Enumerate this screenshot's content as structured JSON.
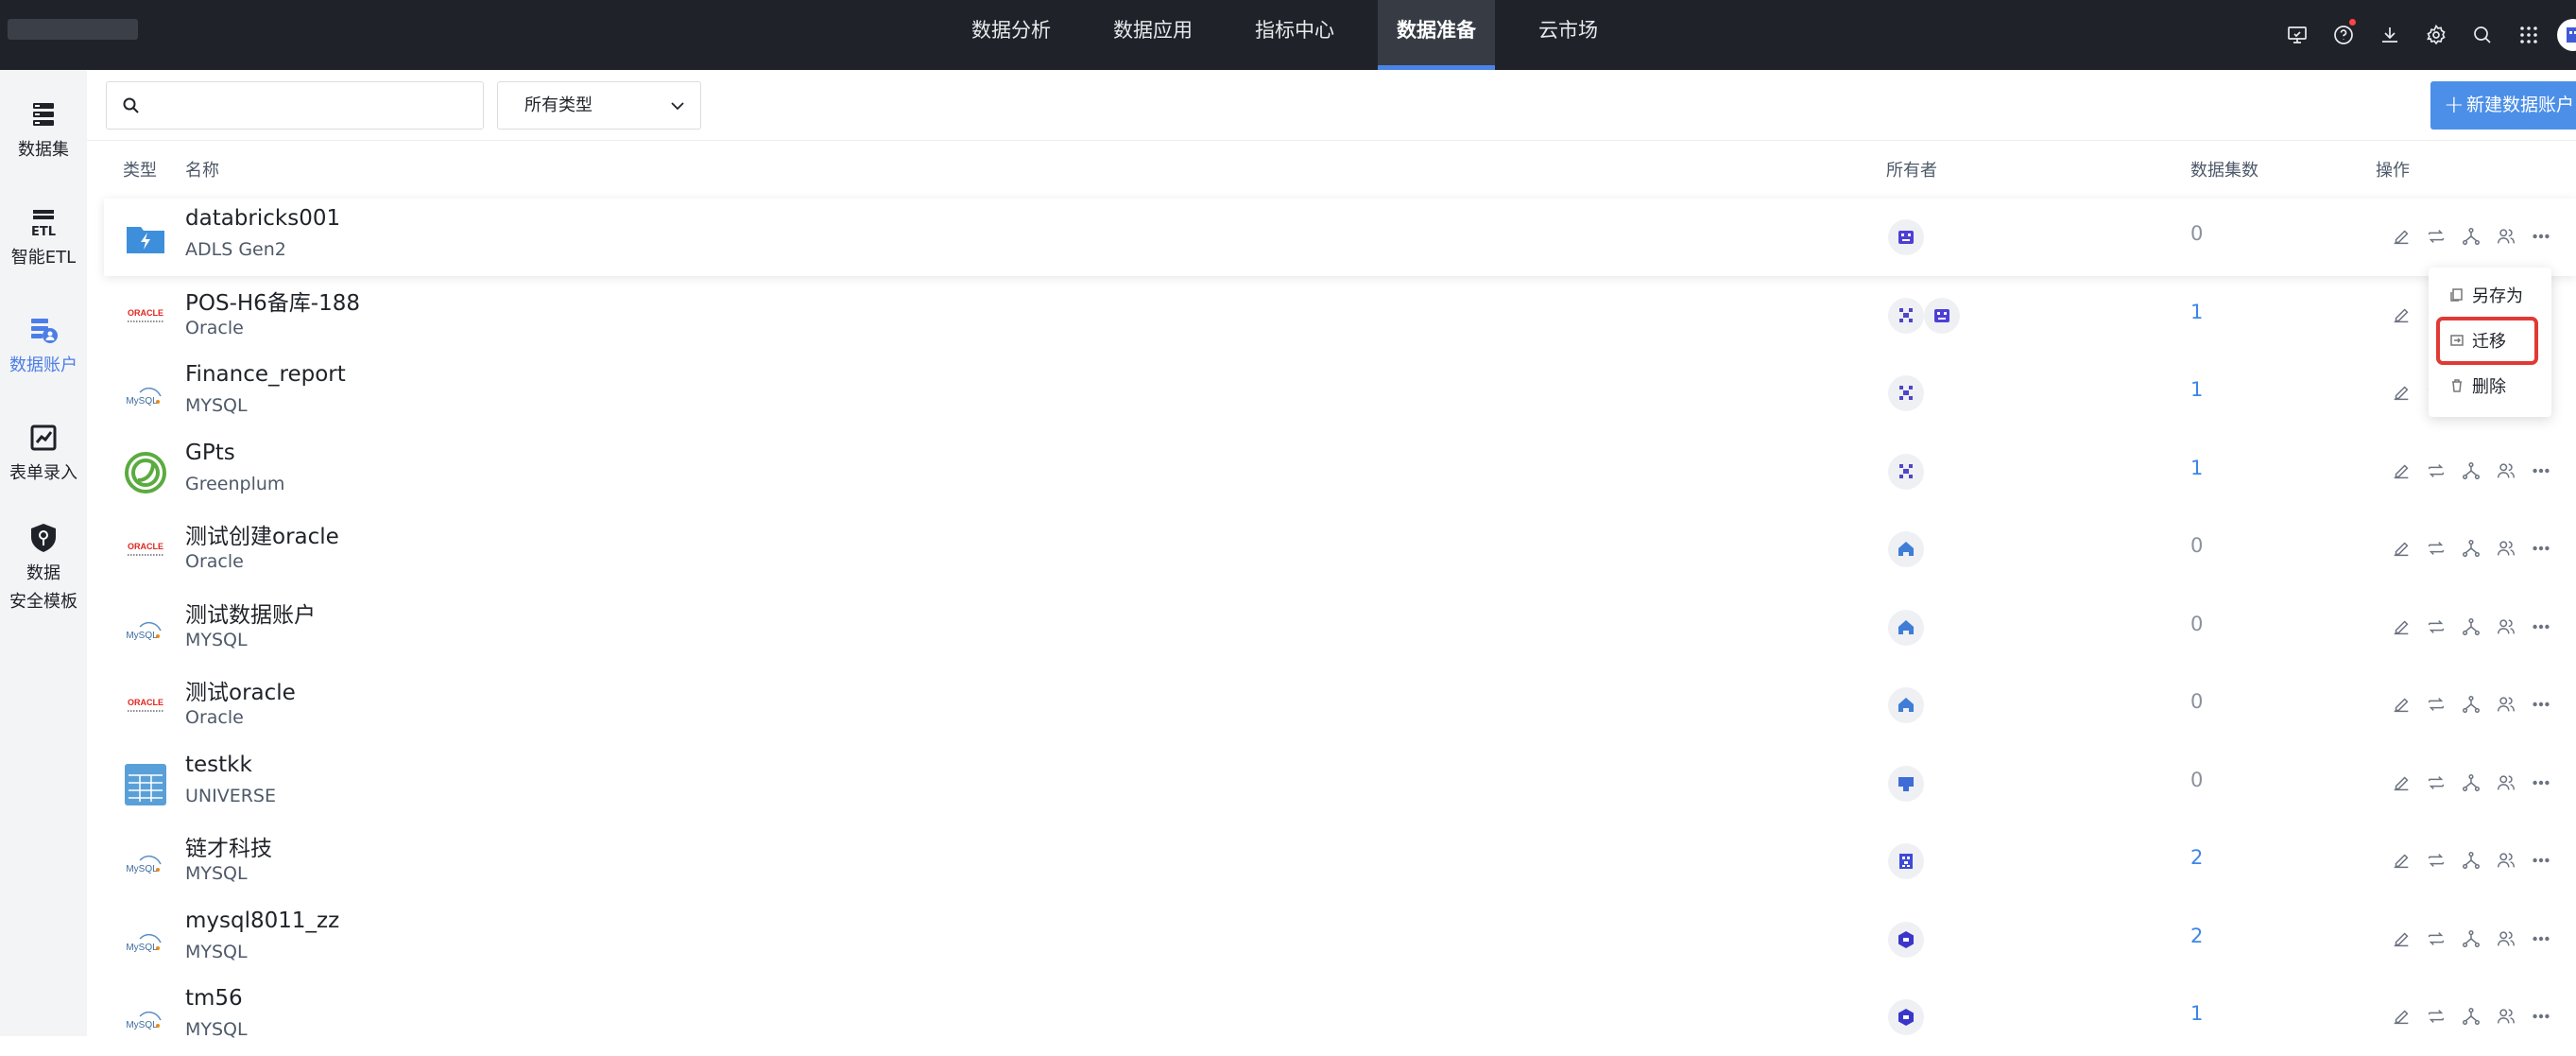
{
  "nav": {
    "items": [
      "数据分析",
      "数据应用",
      "指标中心",
      "数据准备",
      "云市场"
    ],
    "active_index": 3
  },
  "sidebar": {
    "items": [
      {
        "label": "数据集",
        "icon": "dataset-icon"
      },
      {
        "label": "智能ETL",
        "icon": "etl-icon"
      },
      {
        "label": "数据账户",
        "icon": "data-account-icon",
        "active": true
      },
      {
        "label": "表单录入",
        "icon": "form-entry-icon"
      },
      {
        "label_line1": "数据",
        "label_line2": "安全模板",
        "icon": "security-template-icon"
      }
    ]
  },
  "toolbar": {
    "search_placeholder": "",
    "type_filter": "所有类型",
    "new_button": "新建数据账户"
  },
  "table": {
    "headers": {
      "type": "类型",
      "name": "名称",
      "owner": "所有者",
      "dataset_count": "数据集数",
      "actions": "操作"
    },
    "rows": [
      {
        "name": "databricks001",
        "type": "ADLS Gen2",
        "count": "0",
        "logo": "adls-logo"
      },
      {
        "name": "POS-H6备库-188",
        "type": "Oracle",
        "count": "1",
        "logo": "oracle-logo"
      },
      {
        "name": "Finance_report",
        "type": "MYSQL",
        "count": "1",
        "logo": "mysql-logo"
      },
      {
        "name": "GPts",
        "type": "Greenplum",
        "count": "1",
        "logo": "greenplum-logo"
      },
      {
        "name": "测试创建oracle",
        "type": "Oracle",
        "count": "0",
        "logo": "oracle-logo"
      },
      {
        "name": "测试数据账户",
        "type": "MYSQL",
        "count": "0",
        "logo": "mysql-logo"
      },
      {
        "name": "测试oracle",
        "type": "Oracle",
        "count": "0",
        "logo": "oracle-logo"
      },
      {
        "name": "testkk",
        "type": "UNIVERSE",
        "count": "0",
        "logo": "universe-logo"
      },
      {
        "name": "链才科技",
        "type": "MYSQL",
        "count": "2",
        "logo": "mysql-logo"
      },
      {
        "name": "mysql8011_zz",
        "type": "MYSQL",
        "count": "2",
        "logo": "mysql-logo"
      },
      {
        "name": "tm56",
        "type": "MYSQL",
        "count": "1",
        "logo": "mysql-logo"
      }
    ]
  },
  "logo_text": {
    "oracle": "ORACLE",
    "mysql": "MySQL"
  },
  "context_menu": {
    "items": [
      "另存为",
      "迁移",
      "删除"
    ],
    "highlighted": "迁移"
  },
  "colors": {
    "accent": "#4c8fe8",
    "topbar": "#1f2329",
    "highlight_border": "#e03a35"
  }
}
